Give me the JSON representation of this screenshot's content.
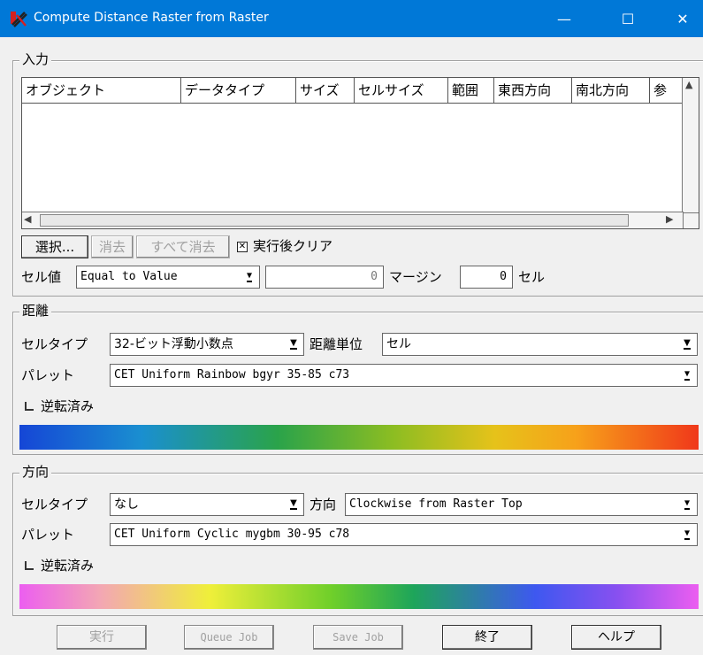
{
  "window": {
    "title": "Compute Distance Raster from Raster",
    "minimize": "—",
    "maximize": "☐",
    "close": "✕"
  },
  "input_group": {
    "label": "入力",
    "columns": [
      "オブジェクト",
      "データタイプ",
      "サイズ",
      "セルサイズ",
      "範囲",
      "東西方向",
      "南北方向",
      "参"
    ],
    "select_label": "選択...",
    "delete_label": "消去",
    "delete_all_label": "すべて消去",
    "clear_after_run_label": "実行後クリア",
    "clear_after_run_checked": true,
    "cell_value_label": "セル値",
    "cell_value_option": "Equal to Value",
    "value": "0",
    "margin_label": "マージン",
    "margin_value": "0",
    "cell_unit_label": "セル"
  },
  "distance_group": {
    "label": "距離",
    "cell_type_label": "セルタイプ",
    "cell_type_value": "32-ビット浮動小数点",
    "distance_unit_label": "距離単位",
    "distance_unit_value": "セル",
    "palette_label": "パレット",
    "palette_value": "CET Uniform Rainbow bgyr 35-85 c73",
    "reversed_label": "逆転済み",
    "reversed_checked": false
  },
  "direction_group": {
    "label": "方向",
    "cell_type_label": "セルタイプ",
    "cell_type_value": "なし",
    "direction_label": "方向",
    "direction_value": "Clockwise from Raster Top",
    "palette_label": "パレット",
    "palette_value": "CET Uniform Cyclic mygbm 30-95 c78",
    "reversed_label": "逆転済み",
    "reversed_checked": false
  },
  "buttons": {
    "run": "実行",
    "queue_job": "Queue Job",
    "save_job": "Save Job",
    "exit": "終了",
    "help": "ヘルプ"
  },
  "colors": {
    "titlebar": "#0078d7",
    "rainbow_palette": [
      "#1546d6",
      "#1a8fd0",
      "#2aa34a",
      "#8cbd22",
      "#e6c21a",
      "#f7a11a",
      "#f0381a"
    ],
    "cyclic_palette": [
      "#ec5ef0",
      "#f3a7b3",
      "#efef3a",
      "#6fcf2a",
      "#1ea55a",
      "#3e58f0",
      "#8850f0",
      "#ec5ef0"
    ]
  }
}
